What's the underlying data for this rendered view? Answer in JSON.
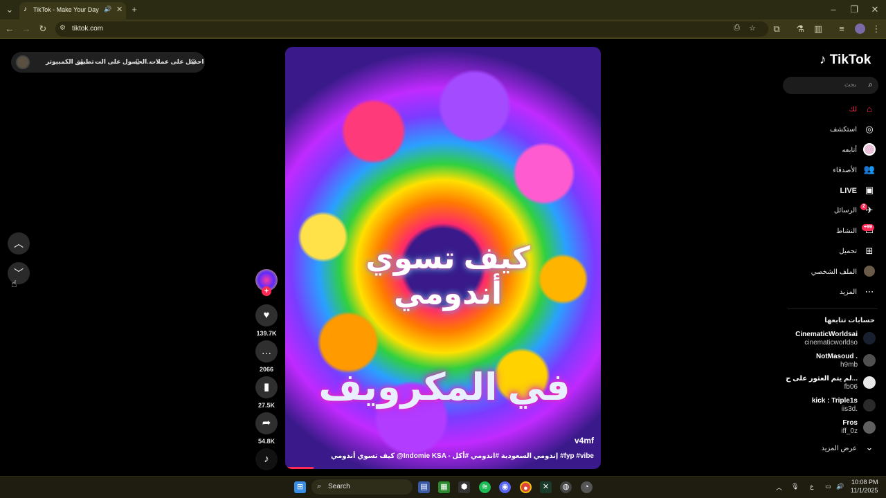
{
  "browser": {
    "tab_title": "TikTok - Make Your Day",
    "url": "tiktok.com"
  },
  "top_pill": {
    "get_coins": "احصل على عملات",
    "get_app": "الحصول على الت...",
    "desktop_app": "تطبيق الكمبيوتر"
  },
  "video": {
    "overlay_line1": "كيف تسوي أندومي",
    "overlay_line2": "في المكرويف",
    "author": "v4mf",
    "caption": "كيف تسوي أندومي @Indomie KSA - إندومي السعودية #اندومي #أكل #fyp #vibe",
    "progress": 0.09
  },
  "actions": {
    "likes": "139.7K",
    "comments": "2066",
    "saves": "27.5K",
    "shares": "54.8K"
  },
  "sidebar": {
    "logo": "TikTok",
    "search_placeholder": "بحث",
    "items": [
      {
        "label": "لك"
      },
      {
        "label": "استكشف"
      },
      {
        "label": "أتابعه"
      },
      {
        "label": "الأصدقاء"
      },
      {
        "label": "LIVE"
      },
      {
        "label": "الرسائل",
        "badge": "2"
      },
      {
        "label": "النشاط",
        "badge": "+99"
      },
      {
        "label": "تحميل"
      },
      {
        "label": "الملف الشخصي"
      },
      {
        "label": "المزيد"
      }
    ],
    "following_title": "حسابات تتابعها",
    "accounts": [
      {
        "name": "CinematicWorldsai",
        "user": "cinematicworldso"
      },
      {
        "name": "NotMasoud .",
        "user": "h9mb"
      },
      {
        "name": "لم يتم العثور على ح...",
        "user": "fb06"
      },
      {
        "name": "kick : Triple1s",
        "user": "iis3d."
      },
      {
        "name": "Fros",
        "user": "iff_0z"
      }
    ],
    "see_more": "عرض المزيد"
  },
  "taskbar": {
    "search_label": "Search",
    "time": "10:08 PM",
    "date": "11/1/2025",
    "lang": "ع"
  },
  "colors": {
    "accent": "#fe2c55",
    "chrome_bg": "#2b2a12",
    "sidebar_bg": "#000000"
  }
}
